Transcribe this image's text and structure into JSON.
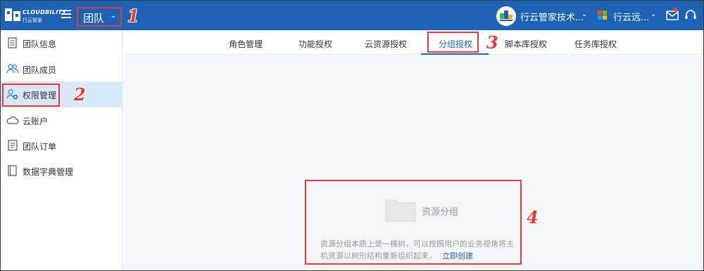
{
  "header": {
    "logo_text": "CLOUDBILITY",
    "logo_sub": "行云管家",
    "team_label": "团队",
    "org_name": "行云管家技术...",
    "tenant_name": "行云远..."
  },
  "callouts": [
    "1",
    "2",
    "3",
    "4"
  ],
  "sidebar": {
    "items": [
      {
        "label": "团队信息",
        "icon": "document-icon"
      },
      {
        "label": "团队成员",
        "icon": "users-icon"
      },
      {
        "label": "权限管理",
        "icon": "user-gear-icon"
      },
      {
        "label": "云账户",
        "icon": "cloud-icon"
      },
      {
        "label": "团队订单",
        "icon": "order-icon"
      },
      {
        "label": "数据字典管理",
        "icon": "book-icon"
      }
    ]
  },
  "tabs": [
    {
      "label": "角色管理"
    },
    {
      "label": "功能授权"
    },
    {
      "label": "云资源授权"
    },
    {
      "label": "分组授权"
    },
    {
      "label": "脚本库授权"
    },
    {
      "label": "任务库授权"
    }
  ],
  "empty_state": {
    "title": "资源分组",
    "desc_line1": "资源分组本质上是一棵树，可以按照用户的业务视角将主",
    "desc_line2": "机资源以树形结构重新组织起来，",
    "link": "立即创建"
  },
  "colors": {
    "brand": "#1e63b3",
    "highlight": "#e23b3b",
    "active_bg": "#d8e8f9"
  }
}
